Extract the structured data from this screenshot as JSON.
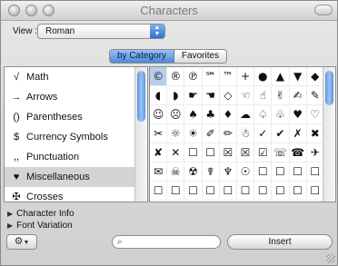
{
  "window": {
    "title": "Characters"
  },
  "view": {
    "label": "View :",
    "selected": "Roman"
  },
  "tabs": [
    "by Category",
    "Favorites"
  ],
  "categories": [
    {
      "icon": "√",
      "label": "Math"
    },
    {
      "icon": "→",
      "label": "Arrows"
    },
    {
      "icon": "()",
      "label": "Parentheses"
    },
    {
      "icon": "$",
      "label": "Currency Symbols"
    },
    {
      "icon": ",,",
      "label": "Punctuation"
    },
    {
      "icon": "♥",
      "label": "Miscellaneous"
    },
    {
      "icon": "✠",
      "label": "Crosses"
    }
  ],
  "characters": [
    "©",
    "®",
    "℗",
    "℠",
    "™",
    "+",
    "●",
    "▲",
    "▼",
    "◆",
    "◖",
    "◗",
    "☛",
    "☚",
    "◇",
    "☜",
    "☝",
    "✌",
    "✍",
    "✎",
    "☺",
    "☹",
    "♠",
    "♣",
    "♦",
    "☁",
    "♤",
    "♧",
    "♥",
    "♡",
    "✂",
    "☼",
    "☀",
    "✐",
    "✏",
    "☃",
    "✓",
    "✔",
    "✗",
    "✖",
    "✘",
    "✕",
    "☐",
    "☐",
    "☒",
    "☒",
    "☑",
    "☏",
    "☎",
    "✈",
    "✉",
    "☠",
    "☢",
    "☤",
    "♆",
    "☉",
    "☐",
    "☐",
    "☐",
    "☐",
    "☐",
    "☐",
    "☐",
    "☐",
    "☐",
    "☐",
    "☐",
    "☐",
    "☐",
    "☐"
  ],
  "disclosures": [
    "Character Info",
    "Font Variation"
  ],
  "search": {
    "placeholder": ""
  },
  "insert_label": "Insert",
  "colors": {
    "accent": "#4a88dc",
    "selection": "#d4d4d4"
  }
}
